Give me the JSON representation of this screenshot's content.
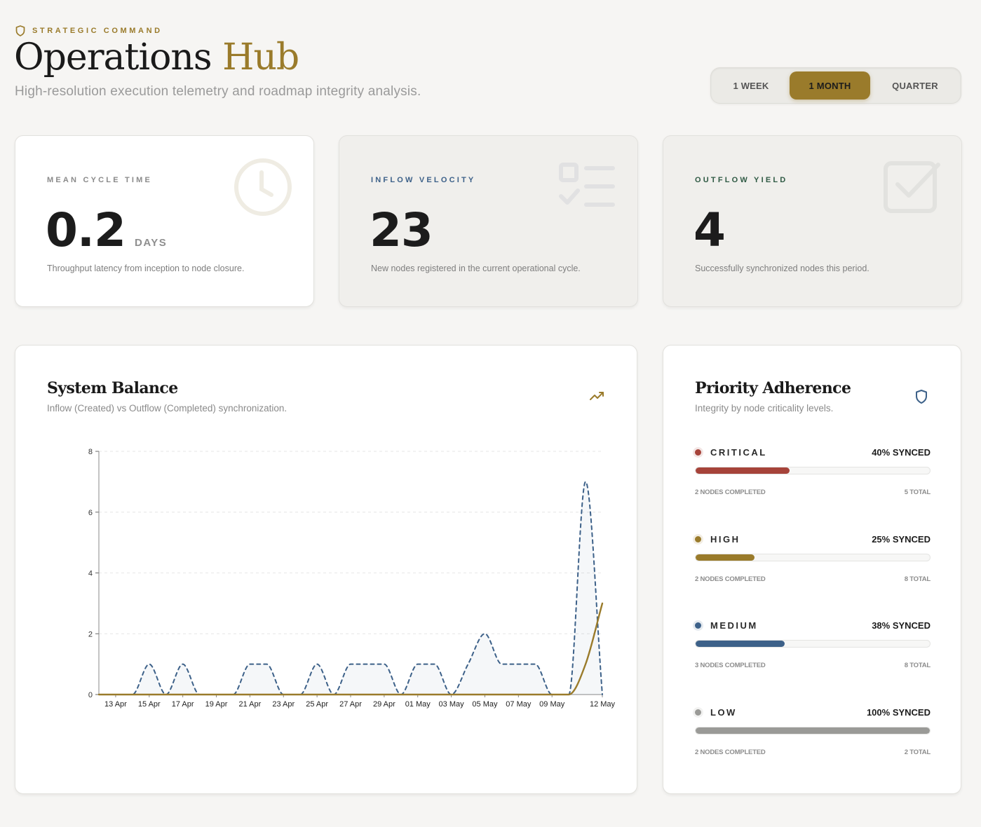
{
  "header": {
    "eyebrow": "STRATEGIC COMMAND",
    "title_main": "Operations",
    "title_accent": "Hub",
    "subtitle": "High-resolution execution telemetry and roadmap integrity analysis."
  },
  "range_selector": {
    "options": [
      "1 WEEK",
      "1 MONTH",
      "QUARTER"
    ],
    "selected": "1 MONTH"
  },
  "kpis": [
    {
      "label": "MEAN CYCLE TIME",
      "value": "0.2",
      "unit": "DAYS",
      "description": "Throughput latency from inception to node closure.",
      "icon": "clock-icon",
      "label_color": "#8a8a8a"
    },
    {
      "label": "INFLOW VELOCITY",
      "value": "23",
      "description": "New nodes registered in the current operational cycle.",
      "icon": "checklist-icon",
      "label_color": "#3d6189"
    },
    {
      "label": "OUTFLOW YIELD",
      "value": "4",
      "description": "Successfully synchronized nodes this period.",
      "icon": "checkbox-icon",
      "label_color": "#2f5a44"
    }
  ],
  "balance": {
    "title": "System Balance",
    "subtitle": "Inflow (Created) vs Outflow (Completed) synchronization.",
    "icon": "trending-up-icon"
  },
  "chart_data": {
    "type": "line",
    "x": [
      "12 Apr",
      "13 Apr",
      "14 Apr",
      "15 Apr",
      "16 Apr",
      "17 Apr",
      "18 Apr",
      "19 Apr",
      "20 Apr",
      "21 Apr",
      "22 Apr",
      "23 Apr",
      "24 Apr",
      "25 Apr",
      "26 Apr",
      "27 Apr",
      "28 Apr",
      "29 Apr",
      "30 Apr",
      "01 May",
      "02 May",
      "03 May",
      "04 May",
      "05 May",
      "06 May",
      "07 May",
      "08 May",
      "09 May",
      "10 May",
      "11 May",
      "12 May"
    ],
    "tick_labels": [
      "13 Apr",
      "15 Apr",
      "17 Apr",
      "19 Apr",
      "21 Apr",
      "23 Apr",
      "25 Apr",
      "27 Apr",
      "29 Apr",
      "01 May",
      "03 May",
      "05 May",
      "07 May",
      "09 May",
      "12 May"
    ],
    "series": [
      {
        "values": [
          0,
          0,
          0,
          1,
          0,
          1,
          0,
          0,
          0,
          1,
          1,
          0,
          0,
          1,
          0,
          1,
          1,
          1,
          0,
          1,
          1,
          0,
          1,
          2,
          1,
          1,
          1,
          0,
          0,
          7,
          0
        ],
        "color": "#3d6189",
        "style": "dashed"
      },
      {
        "values": [
          0,
          0,
          0,
          0,
          0,
          0,
          0,
          0,
          0,
          0,
          0,
          0,
          0,
          0,
          0,
          0,
          0,
          0,
          0,
          0,
          0,
          0,
          0,
          0,
          0,
          0,
          0,
          0,
          0,
          1,
          3
        ],
        "color": "#9a7b2b",
        "style": "solid"
      }
    ],
    "ylim": [
      0,
      8
    ],
    "yticks": [
      0,
      2,
      4,
      6,
      8
    ],
    "grid": true
  },
  "priority": {
    "title": "Priority Adherence",
    "subtitle": "Integrity by node criticality levels.",
    "icon": "shield-icon",
    "items": [
      {
        "name": "CRITICAL",
        "pct_label": "40% SYNCED",
        "fraction": 0.4,
        "completed": "2 NODES COMPLETED",
        "total": "5 TOTAL",
        "color": "#a6433a"
      },
      {
        "name": "HIGH",
        "pct_label": "25% SYNCED",
        "fraction": 0.25,
        "completed": "2 NODES COMPLETED",
        "total": "8 TOTAL",
        "color": "#9a7b2b"
      },
      {
        "name": "MEDIUM",
        "pct_label": "38% SYNCED",
        "fraction": 0.38,
        "completed": "3 NODES COMPLETED",
        "total": "8 TOTAL",
        "color": "#3d6189"
      },
      {
        "name": "LOW",
        "pct_label": "100% SYNCED",
        "fraction": 1.0,
        "completed": "2 NODES COMPLETED",
        "total": "2 TOTAL",
        "color": "#9a9a97"
      }
    ]
  }
}
